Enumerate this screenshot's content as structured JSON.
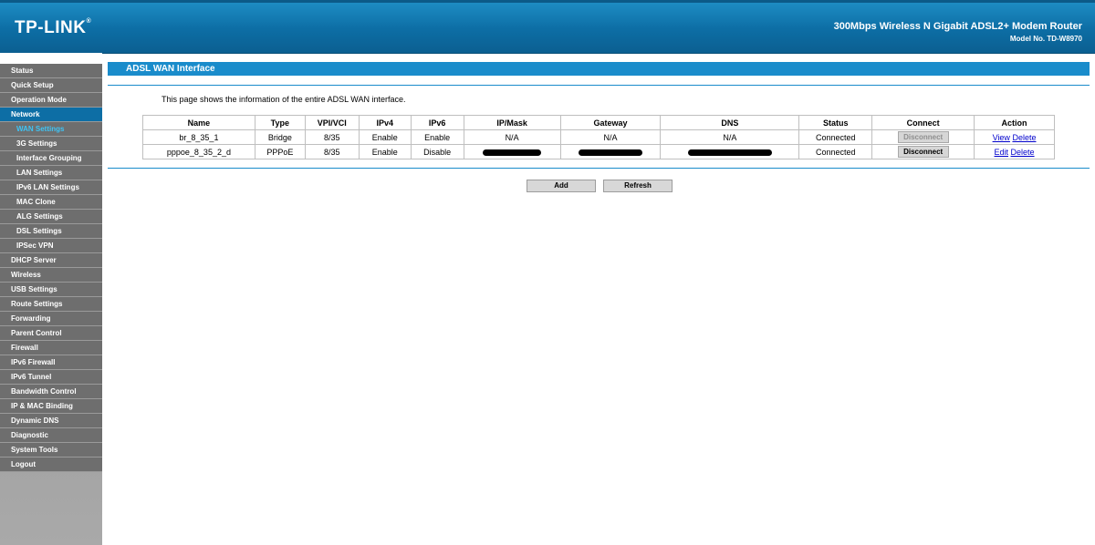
{
  "header": {
    "logo": "TP-LINK",
    "logo_mark": "®",
    "product": "300Mbps Wireless N Gigabit ADSL2+ Modem Router",
    "model": "Model No. TD-W8970"
  },
  "sidebar": {
    "items": [
      {
        "label": "Status"
      },
      {
        "label": "Quick Setup"
      },
      {
        "label": "Operation Mode"
      },
      {
        "label": "Network"
      },
      {
        "label": "WAN Settings"
      },
      {
        "label": "3G Settings"
      },
      {
        "label": "Interface Grouping"
      },
      {
        "label": "LAN Settings"
      },
      {
        "label": "IPv6 LAN Settings"
      },
      {
        "label": "MAC Clone"
      },
      {
        "label": "ALG Settings"
      },
      {
        "label": "DSL Settings"
      },
      {
        "label": "IPSec VPN"
      },
      {
        "label": "DHCP Server"
      },
      {
        "label": "Wireless"
      },
      {
        "label": "USB Settings"
      },
      {
        "label": "Route Settings"
      },
      {
        "label": "Forwarding"
      },
      {
        "label": "Parent Control"
      },
      {
        "label": "Firewall"
      },
      {
        "label": "IPv6 Firewall"
      },
      {
        "label": "IPv6 Tunnel"
      },
      {
        "label": "Bandwidth Control"
      },
      {
        "label": "IP & MAC Binding"
      },
      {
        "label": "Dynamic DNS"
      },
      {
        "label": "Diagnostic"
      },
      {
        "label": "System Tools"
      },
      {
        "label": "Logout"
      }
    ]
  },
  "main": {
    "title": "ADSL WAN Interface",
    "intro": "This page shows the information of the entire ADSL WAN interface.",
    "columns": [
      "Name",
      "Type",
      "VPI/VCI",
      "IPv4",
      "IPv6",
      "IP/Mask",
      "Gateway",
      "DNS",
      "Status",
      "Connect",
      "Action"
    ],
    "rows": [
      {
        "name": "br_8_35_1",
        "type": "Bridge",
        "vpivci": "8/35",
        "ipv4": "Enable",
        "ipv6": "Enable",
        "ipmask": "N/A",
        "gateway": "N/A",
        "dns": "N/A",
        "status": "Connected",
        "connect": "Disconnect",
        "action1": "View",
        "action2": "Delete"
      },
      {
        "name": "pppoe_8_35_2_d",
        "type": "PPPoE",
        "vpivci": "8/35",
        "ipv4": "Enable",
        "ipv6": "Disable",
        "ipmask": "",
        "gateway": "",
        "dns": "",
        "status": "Connected",
        "connect": "Disconnect",
        "action1": "Edit",
        "action2": "Delete"
      }
    ],
    "add_label": "Add",
    "refresh_label": "Refresh"
  }
}
